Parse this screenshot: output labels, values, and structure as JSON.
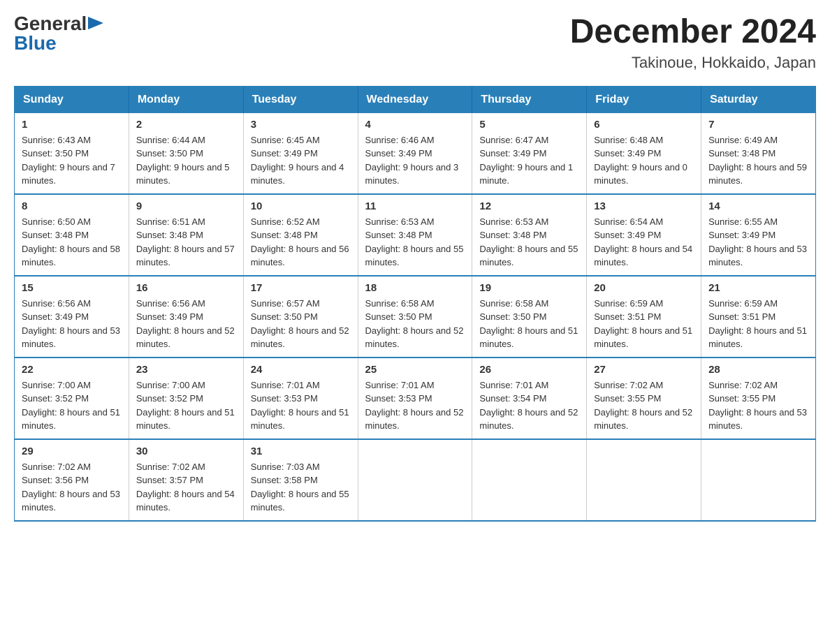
{
  "header": {
    "logo": {
      "general": "General",
      "arrow": "▶",
      "blue": "Blue"
    },
    "title": "December 2024",
    "location": "Takinoue, Hokkaido, Japan"
  },
  "calendar": {
    "weekdays": [
      "Sunday",
      "Monday",
      "Tuesday",
      "Wednesday",
      "Thursday",
      "Friday",
      "Saturday"
    ],
    "weeks": [
      [
        {
          "day": "1",
          "sunrise": "6:43 AM",
          "sunset": "3:50 PM",
          "daylight": "9 hours and 7 minutes."
        },
        {
          "day": "2",
          "sunrise": "6:44 AM",
          "sunset": "3:50 PM",
          "daylight": "9 hours and 5 minutes."
        },
        {
          "day": "3",
          "sunrise": "6:45 AM",
          "sunset": "3:49 PM",
          "daylight": "9 hours and 4 minutes."
        },
        {
          "day": "4",
          "sunrise": "6:46 AM",
          "sunset": "3:49 PM",
          "daylight": "9 hours and 3 minutes."
        },
        {
          "day": "5",
          "sunrise": "6:47 AM",
          "sunset": "3:49 PM",
          "daylight": "9 hours and 1 minute."
        },
        {
          "day": "6",
          "sunrise": "6:48 AM",
          "sunset": "3:49 PM",
          "daylight": "9 hours and 0 minutes."
        },
        {
          "day": "7",
          "sunrise": "6:49 AM",
          "sunset": "3:48 PM",
          "daylight": "8 hours and 59 minutes."
        }
      ],
      [
        {
          "day": "8",
          "sunrise": "6:50 AM",
          "sunset": "3:48 PM",
          "daylight": "8 hours and 58 minutes."
        },
        {
          "day": "9",
          "sunrise": "6:51 AM",
          "sunset": "3:48 PM",
          "daylight": "8 hours and 57 minutes."
        },
        {
          "day": "10",
          "sunrise": "6:52 AM",
          "sunset": "3:48 PM",
          "daylight": "8 hours and 56 minutes."
        },
        {
          "day": "11",
          "sunrise": "6:53 AM",
          "sunset": "3:48 PM",
          "daylight": "8 hours and 55 minutes."
        },
        {
          "day": "12",
          "sunrise": "6:53 AM",
          "sunset": "3:48 PM",
          "daylight": "8 hours and 55 minutes."
        },
        {
          "day": "13",
          "sunrise": "6:54 AM",
          "sunset": "3:49 PM",
          "daylight": "8 hours and 54 minutes."
        },
        {
          "day": "14",
          "sunrise": "6:55 AM",
          "sunset": "3:49 PM",
          "daylight": "8 hours and 53 minutes."
        }
      ],
      [
        {
          "day": "15",
          "sunrise": "6:56 AM",
          "sunset": "3:49 PM",
          "daylight": "8 hours and 53 minutes."
        },
        {
          "day": "16",
          "sunrise": "6:56 AM",
          "sunset": "3:49 PM",
          "daylight": "8 hours and 52 minutes."
        },
        {
          "day": "17",
          "sunrise": "6:57 AM",
          "sunset": "3:50 PM",
          "daylight": "8 hours and 52 minutes."
        },
        {
          "day": "18",
          "sunrise": "6:58 AM",
          "sunset": "3:50 PM",
          "daylight": "8 hours and 52 minutes."
        },
        {
          "day": "19",
          "sunrise": "6:58 AM",
          "sunset": "3:50 PM",
          "daylight": "8 hours and 51 minutes."
        },
        {
          "day": "20",
          "sunrise": "6:59 AM",
          "sunset": "3:51 PM",
          "daylight": "8 hours and 51 minutes."
        },
        {
          "day": "21",
          "sunrise": "6:59 AM",
          "sunset": "3:51 PM",
          "daylight": "8 hours and 51 minutes."
        }
      ],
      [
        {
          "day": "22",
          "sunrise": "7:00 AM",
          "sunset": "3:52 PM",
          "daylight": "8 hours and 51 minutes."
        },
        {
          "day": "23",
          "sunrise": "7:00 AM",
          "sunset": "3:52 PM",
          "daylight": "8 hours and 51 minutes."
        },
        {
          "day": "24",
          "sunrise": "7:01 AM",
          "sunset": "3:53 PM",
          "daylight": "8 hours and 51 minutes."
        },
        {
          "day": "25",
          "sunrise": "7:01 AM",
          "sunset": "3:53 PM",
          "daylight": "8 hours and 52 minutes."
        },
        {
          "day": "26",
          "sunrise": "7:01 AM",
          "sunset": "3:54 PM",
          "daylight": "8 hours and 52 minutes."
        },
        {
          "day": "27",
          "sunrise": "7:02 AM",
          "sunset": "3:55 PM",
          "daylight": "8 hours and 52 minutes."
        },
        {
          "day": "28",
          "sunrise": "7:02 AM",
          "sunset": "3:55 PM",
          "daylight": "8 hours and 53 minutes."
        }
      ],
      [
        {
          "day": "29",
          "sunrise": "7:02 AM",
          "sunset": "3:56 PM",
          "daylight": "8 hours and 53 minutes."
        },
        {
          "day": "30",
          "sunrise": "7:02 AM",
          "sunset": "3:57 PM",
          "daylight": "8 hours and 54 minutes."
        },
        {
          "day": "31",
          "sunrise": "7:03 AM",
          "sunset": "3:58 PM",
          "daylight": "8 hours and 55 minutes."
        },
        null,
        null,
        null,
        null
      ]
    ]
  }
}
